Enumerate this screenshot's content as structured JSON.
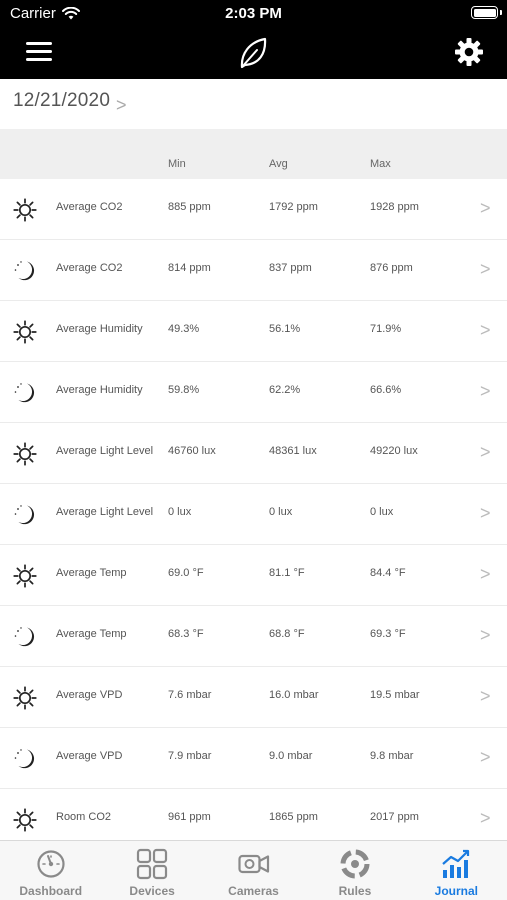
{
  "status_bar": {
    "carrier": "Carrier",
    "time": "2:03 PM"
  },
  "nav": {
    "menu_icon": "hamburger-icon",
    "logo_icon": "leaf-icon",
    "settings_icon": "gear-icon"
  },
  "date": {
    "value": "12/21/2020",
    "chevron": ">"
  },
  "columns": {
    "min": "Min",
    "avg": "Avg",
    "max": "Max"
  },
  "rows": [
    {
      "period": "day",
      "label": "Average CO2",
      "min": "885 ppm",
      "avg": "1792 ppm",
      "max": "1928 ppm",
      "chevron": ">"
    },
    {
      "period": "night",
      "label": "Average CO2",
      "min": "814 ppm",
      "avg": "837 ppm",
      "max": "876 ppm",
      "chevron": ">"
    },
    {
      "period": "day",
      "label": "Average Humidity",
      "min": "49.3%",
      "avg": "56.1%",
      "max": "71.9%",
      "chevron": ">"
    },
    {
      "period": "night",
      "label": "Average Humidity",
      "min": "59.8%",
      "avg": "62.2%",
      "max": "66.6%",
      "chevron": ">"
    },
    {
      "period": "day",
      "label": "Average Light Level",
      "min": "46760 lux",
      "avg": "48361 lux",
      "max": "49220 lux",
      "chevron": ">"
    },
    {
      "period": "night",
      "label": "Average Light Level",
      "min": "0 lux",
      "avg": "0 lux",
      "max": "0 lux",
      "chevron": ">"
    },
    {
      "period": "day",
      "label": "Average Temp",
      "min": "69.0 °F",
      "avg": "81.1 °F",
      "max": "84.4 °F",
      "chevron": ">"
    },
    {
      "period": "night",
      "label": "Average Temp",
      "min": "68.3 °F",
      "avg": "68.8 °F",
      "max": "69.3 °F",
      "chevron": ">"
    },
    {
      "period": "day",
      "label": "Average VPD",
      "min": "7.6 mbar",
      "avg": "16.0 mbar",
      "max": "19.5 mbar",
      "chevron": ">"
    },
    {
      "period": "night",
      "label": "Average VPD",
      "min": "7.9 mbar",
      "avg": "9.0 mbar",
      "max": "9.8 mbar",
      "chevron": ">"
    },
    {
      "period": "day",
      "label": "Room CO2",
      "min": "961 ppm",
      "avg": "1865 ppm",
      "max": "2017 ppm",
      "chevron": ">"
    }
  ],
  "tabs": [
    {
      "label": "Dashboard",
      "icon": "gauge-icon",
      "active": false
    },
    {
      "label": "Devices",
      "icon": "grid-icon",
      "active": false
    },
    {
      "label": "Cameras",
      "icon": "camera-icon",
      "active": false
    },
    {
      "label": "Rules",
      "icon": "rules-icon",
      "active": false
    },
    {
      "label": "Journal",
      "icon": "chart-icon",
      "active": true
    }
  ],
  "colors": {
    "accent": "#1a7be0",
    "header_bg": "#000000",
    "tab_inactive": "#8a8a8a"
  }
}
